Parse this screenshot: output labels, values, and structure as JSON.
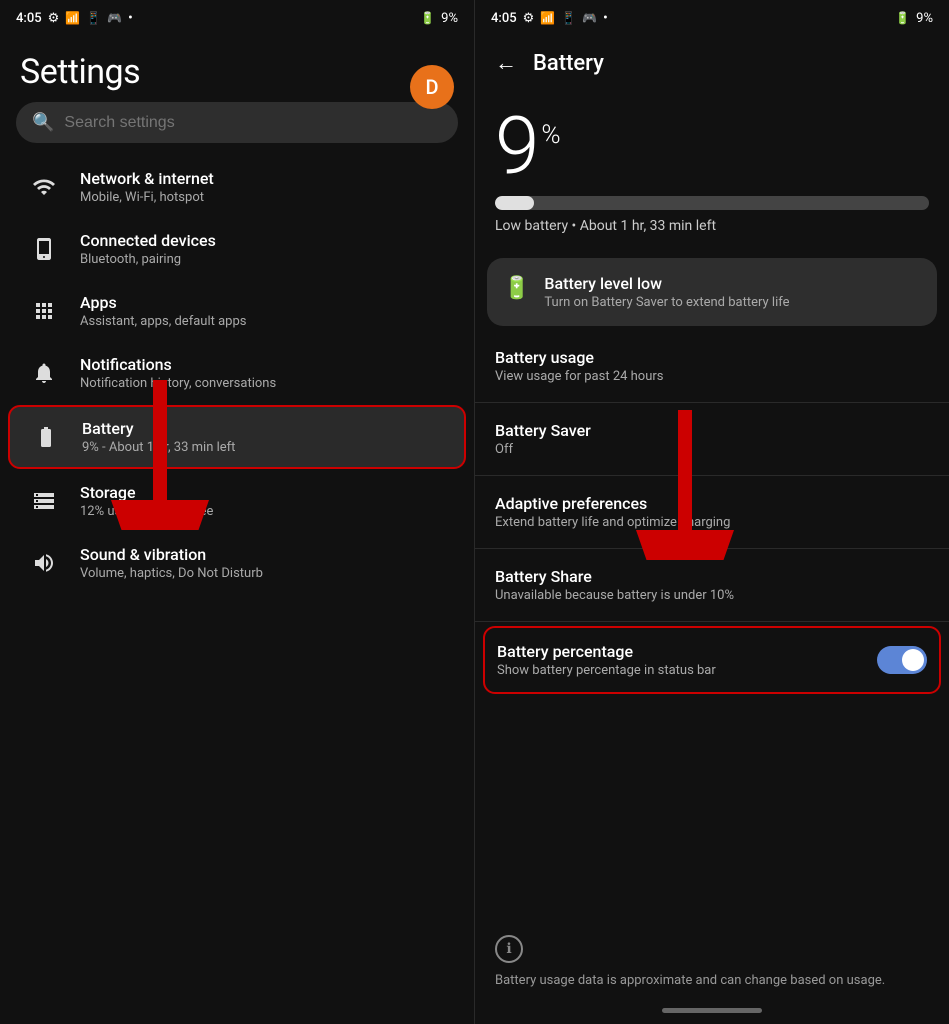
{
  "left": {
    "statusBar": {
      "time": "4:05",
      "battery": "9%"
    },
    "avatar": "D",
    "title": "Settings",
    "search": {
      "placeholder": "Search settings"
    },
    "items": [
      {
        "id": "network",
        "icon": "wifi",
        "title": "Network & internet",
        "subtitle": "Mobile, Wi-Fi, hotspot"
      },
      {
        "id": "connected",
        "icon": "devices",
        "title": "Connected devices",
        "subtitle": "Bluetooth, pairing"
      },
      {
        "id": "apps",
        "icon": "apps",
        "title": "Apps",
        "subtitle": "Assistant, apps, default apps"
      },
      {
        "id": "notifications",
        "icon": "bell",
        "title": "Notifications",
        "subtitle": "Notification history, conversations"
      },
      {
        "id": "battery",
        "icon": "battery",
        "title": "Battery",
        "subtitle": "9% - About 1 hr, 33 min left",
        "active": true
      },
      {
        "id": "storage",
        "icon": "storage",
        "title": "Storage",
        "subtitle": "12% used - 113 GB free"
      },
      {
        "id": "sound",
        "icon": "sound",
        "title": "Sound & vibration",
        "subtitle": "Volume, haptics, Do Not Disturb"
      }
    ]
  },
  "right": {
    "statusBar": {
      "time": "4:05",
      "battery": "9%"
    },
    "pageTitle": "Battery",
    "batteryPercent": "9",
    "batteryBarWidth": "9",
    "batteryStatusText": "Low battery • About 1 hr, 33 min left",
    "alert": {
      "title": "Battery level low",
      "subtitle": "Turn on Battery Saver to extend battery life"
    },
    "menuItems": [
      {
        "id": "usage",
        "title": "Battery usage",
        "subtitle": "View usage for past 24 hours",
        "hasToggle": false,
        "active": false
      },
      {
        "id": "saver",
        "title": "Battery Saver",
        "subtitle": "Off",
        "hasToggle": false,
        "active": false
      },
      {
        "id": "adaptive",
        "title": "Adaptive preferences",
        "subtitle": "Extend battery life and optimize charging",
        "hasToggle": false,
        "active": false
      },
      {
        "id": "share",
        "title": "Battery Share",
        "subtitle": "Unavailable because battery is under 10%",
        "hasToggle": false,
        "active": false
      },
      {
        "id": "percentage",
        "title": "Battery percentage",
        "subtitle": "Show battery percentage in status bar",
        "hasToggle": true,
        "active": true
      }
    ],
    "infoText": "Battery usage data is approximate and can change based on usage."
  }
}
